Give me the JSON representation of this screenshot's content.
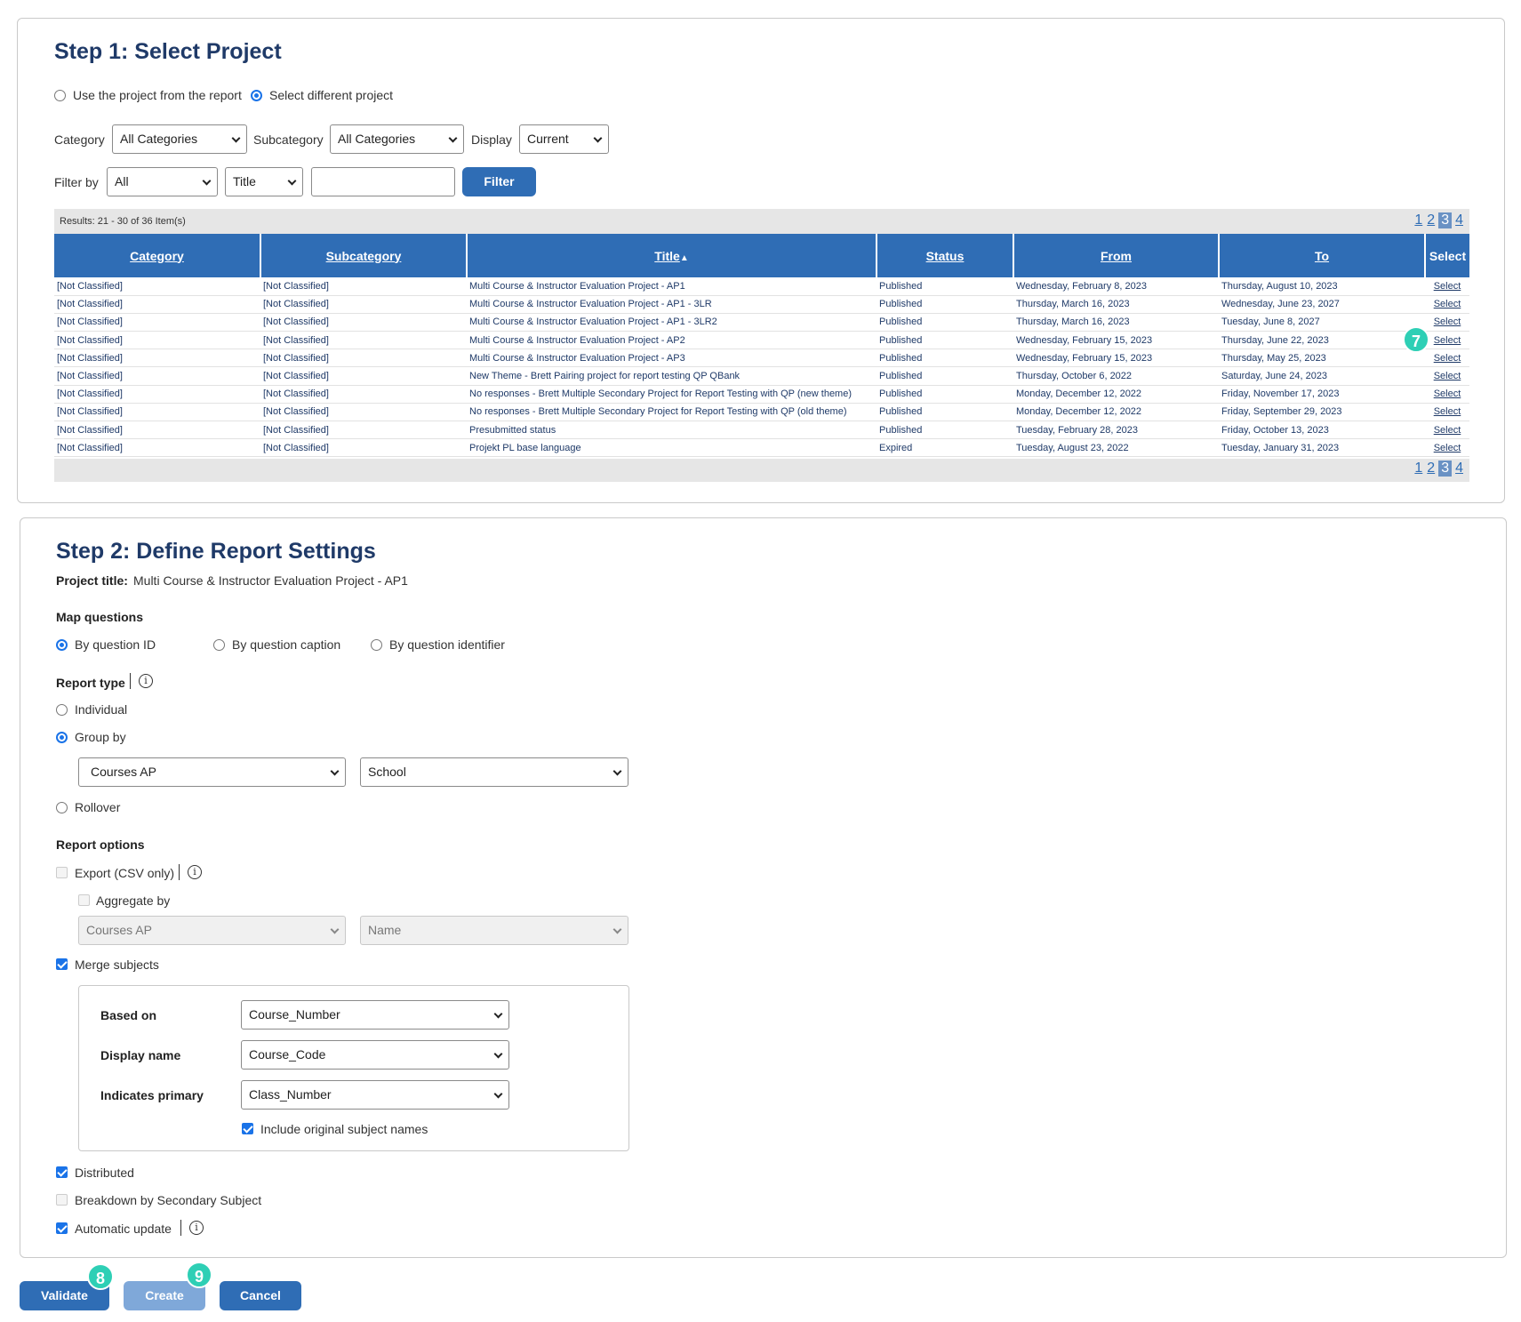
{
  "step1": {
    "title": "Step 1: Select Project",
    "radio_use_report": "Use the project from the report",
    "radio_select_different": "Select different project",
    "category_label": "Category",
    "category_value": "All Categories",
    "subcategory_label": "Subcategory",
    "subcategory_value": "All Categories",
    "display_label": "Display",
    "display_value": "Current",
    "filterby_label": "Filter by",
    "filter_scope_value": "All",
    "filter_field_value": "Title",
    "filter_text_value": "",
    "filter_button": "Filter",
    "results_text": "Results: 21 - 30 of 36 Item(s)",
    "pages": [
      "1",
      "2",
      "3",
      "4"
    ],
    "current_page": "3",
    "columns": [
      "Category",
      "Subcategory",
      "Title",
      "Status",
      "From",
      "To",
      "Select"
    ],
    "sort_indicator": "▲",
    "rows": [
      [
        "[Not Classified]",
        "[Not Classified]",
        "Multi Course & Instructor Evaluation Project - AP1",
        "Published",
        "Wednesday, February 8, 2023",
        "Thursday, August 10, 2023",
        "Select"
      ],
      [
        "[Not Classified]",
        "[Not Classified]",
        "Multi Course & Instructor Evaluation Project - AP1 - 3LR",
        "Published",
        "Thursday, March 16, 2023",
        "Wednesday, June 23, 2027",
        "Select"
      ],
      [
        "[Not Classified]",
        "[Not Classified]",
        "Multi Course & Instructor Evaluation Project - AP1 - 3LR2",
        "Published",
        "Thursday, March 16, 2023",
        "Tuesday, June 8, 2027",
        "Select"
      ],
      [
        "[Not Classified]",
        "[Not Classified]",
        "Multi Course & Instructor Evaluation Project - AP2",
        "Published",
        "Wednesday, February 15, 2023",
        "Thursday, June 22, 2023",
        "Select"
      ],
      [
        "[Not Classified]",
        "[Not Classified]",
        "Multi Course & Instructor Evaluation Project - AP3",
        "Published",
        "Wednesday, February 15, 2023",
        "Thursday, May 25, 2023",
        "Select"
      ],
      [
        "[Not Classified]",
        "[Not Classified]",
        "New Theme - Brett Pairing project for report testing QP QBank",
        "Published",
        "Thursday, October 6, 2022",
        "Saturday, June 24, 2023",
        "Select"
      ],
      [
        "[Not Classified]",
        "[Not Classified]",
        "No responses - Brett Multiple Secondary Project for Report Testing with QP (new theme)",
        "Published",
        "Monday, December 12, 2022",
        "Friday, November 17, 2023",
        "Select"
      ],
      [
        "[Not Classified]",
        "[Not Classified]",
        "No responses - Brett Multiple Secondary Project for Report Testing with QP (old theme)",
        "Published",
        "Monday, December 12, 2022",
        "Friday, September 29, 2023",
        "Select"
      ],
      [
        "[Not Classified]",
        "[Not Classified]",
        "Presubmitted status",
        "Published",
        "Tuesday, February 28, 2023",
        "Friday, October 13, 2023",
        "Select"
      ],
      [
        "[Not Classified]",
        "[Not Classified]",
        "Projekt PL base language",
        "Expired",
        "Tuesday, August 23, 2022",
        "Tuesday, January 31, 2023",
        "Select"
      ]
    ]
  },
  "step2": {
    "title": "Step 2: Define Report Settings",
    "project_title_label": "Project title:",
    "project_title_value": "Multi Course & Instructor Evaluation Project - AP1",
    "map_questions_label": "Map questions",
    "map_by_id": "By question ID",
    "map_by_caption": "By question caption",
    "map_by_identifier": "By question identifier",
    "report_type_label": "Report type",
    "type_individual": "Individual",
    "type_group_by": "Group by",
    "group_by_primary": "Courses AP",
    "group_by_secondary": "School",
    "type_rollover": "Rollover",
    "report_options_label": "Report options",
    "export_csv": "Export (CSV only)",
    "aggregate_by": "Aggregate by",
    "aggregate_primary": "Courses AP",
    "aggregate_secondary": "Name",
    "merge_subjects": "Merge subjects",
    "based_on_label": "Based on",
    "based_on_value": "Course_Number",
    "display_name_label": "Display name",
    "display_name_value": "Course_Code",
    "indicates_primary_label": "Indicates primary",
    "indicates_primary_value": "Class_Number",
    "include_original": "Include original subject names",
    "distributed": "Distributed",
    "breakdown_secondary": "Breakdown by Secondary Subject",
    "automatic_update": "Automatic update"
  },
  "actions": {
    "validate": "Validate",
    "create": "Create",
    "cancel": "Cancel"
  },
  "badges": {
    "b7": "7",
    "b8": "8",
    "b9": "9"
  },
  "colors": {
    "accent": "#2f6db5",
    "title": "#1f3a68",
    "badge": "#2ecfb5"
  }
}
